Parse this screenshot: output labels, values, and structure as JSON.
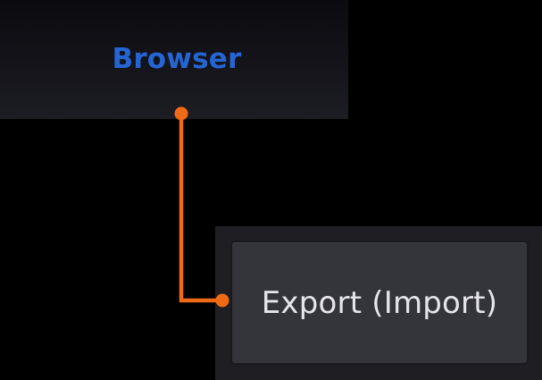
{
  "top_panel": {
    "label": "Browser"
  },
  "bottom_panel": {
    "button_label": "Export (Import)"
  },
  "colors": {
    "accent_blue": "#2565d3",
    "connector_orange": "#f06a16",
    "background": "#000000",
    "panel": "#1f1f23",
    "button": "#34343b",
    "button_text": "#e6e6ea"
  }
}
